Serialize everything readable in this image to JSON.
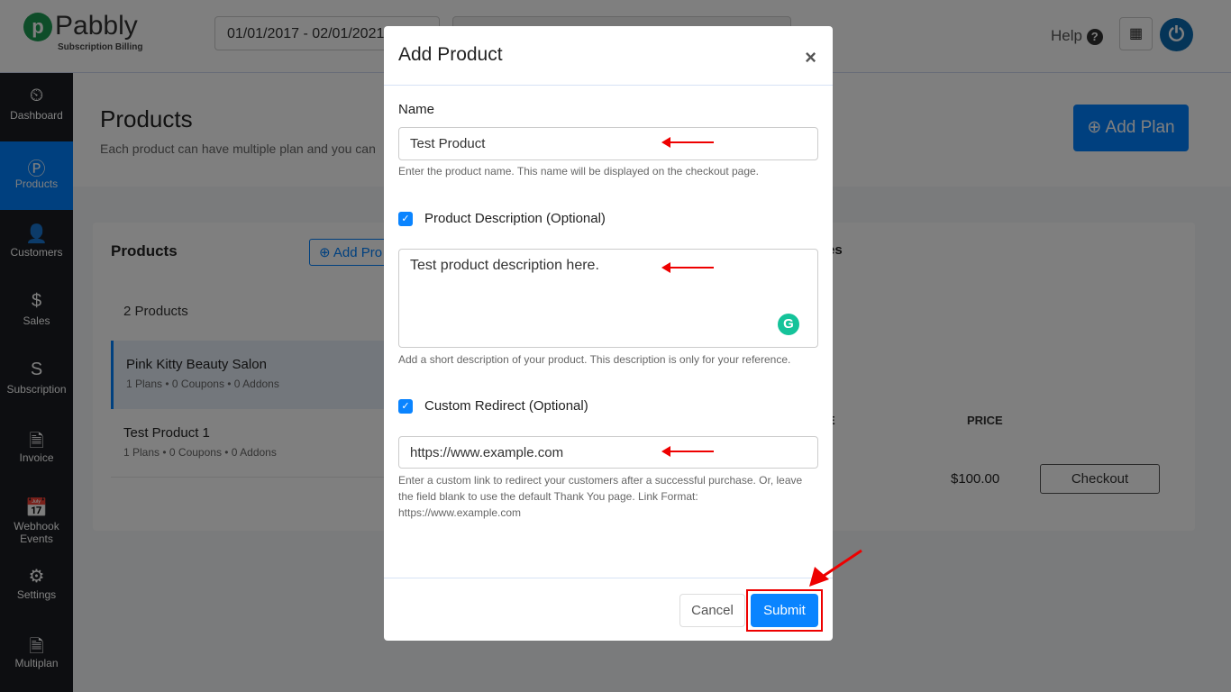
{
  "header": {
    "logo_text": "Pabbly",
    "logo_sub": "Subscription Billing",
    "date_range": "01/01/2017 - 02/01/2021",
    "help": "Help",
    "icons": [
      "question-icon",
      "apps-grid-icon",
      "power-icon"
    ]
  },
  "sidebar": {
    "items": [
      {
        "label": "Dashboard",
        "icon": "⏲"
      },
      {
        "label": "Products",
        "icon": "Ⓟ",
        "active": true
      },
      {
        "label": "Customers",
        "icon": "👤"
      },
      {
        "label": "Sales",
        "icon": "$"
      },
      {
        "label": "Subscription",
        "icon": "S"
      },
      {
        "label": "Invoice",
        "icon": "🗎"
      },
      {
        "label": "Webhook Events",
        "icon": "📅"
      },
      {
        "label": "Settings",
        "icon": "⚙"
      },
      {
        "label": "Multiplan",
        "icon": "🗎"
      }
    ]
  },
  "page": {
    "title": "Products",
    "subtitle": "Each product can have multiple plan and you can",
    "add_plan": "Add Plan"
  },
  "card": {
    "title": "Products",
    "add_product": "Add Pro",
    "count": "2 Products",
    "tab_partial": "es",
    "products": [
      {
        "name": "Pink Kitty Beauty Salon",
        "meta": "1 Plans  • 0 Coupons  • 0 Addons"
      },
      {
        "name": "Test Product 1",
        "meta": "1 Plans  • 0 Coupons  • 0 Addons"
      }
    ],
    "col_partial": "E",
    "col_price": "PRICE",
    "price": "$100.00",
    "checkout": "Checkout"
  },
  "modal": {
    "title": "Add Product",
    "close": "×",
    "name_label": "Name",
    "name_value": "Test Product",
    "name_hint": "Enter the product name. This name will be displayed on the checkout page.",
    "desc_label": "Product Description (Optional)",
    "desc_checked": true,
    "desc_value": "Test product description here.",
    "desc_hint": "Add a short description of your product. This description is only for your reference.",
    "redirect_label": "Custom Redirect (Optional)",
    "redirect_checked": true,
    "redirect_value": "https://www.example.com",
    "redirect_hint": "Enter a custom link to redirect your customers after a successful purchase. Or, leave the field blank to use the default Thank You page. Link Format: https://www.example.com",
    "cancel": "Cancel",
    "submit": "Submit"
  },
  "colors": {
    "accent": "#0a84ff",
    "annotation": "#ee0000",
    "brand_green": "#1d9a52"
  }
}
